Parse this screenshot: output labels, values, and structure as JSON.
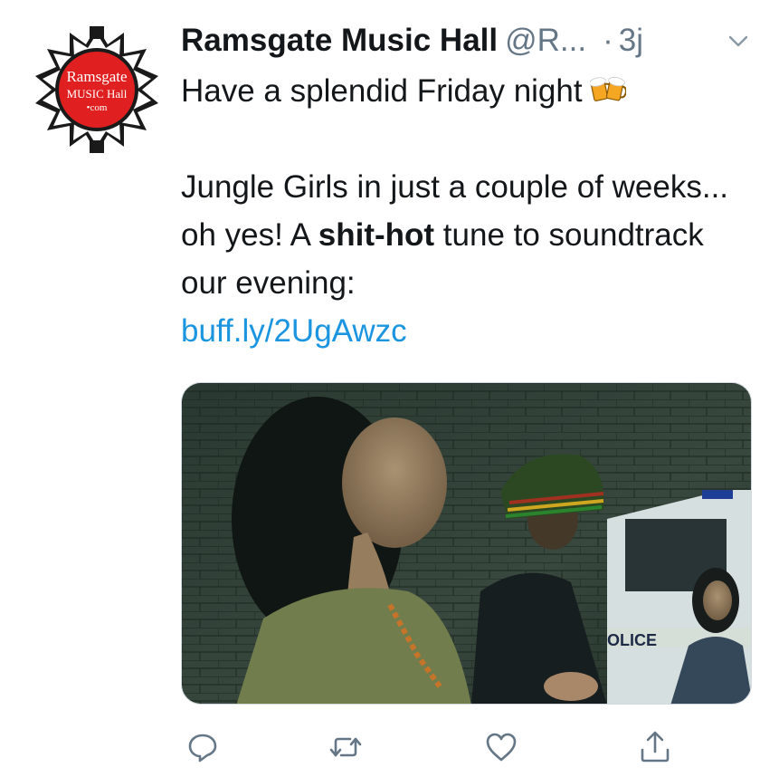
{
  "tweet": {
    "author": {
      "display_name": "Ramsgate Music Hall",
      "handle": "@R...",
      "avatar_icon": "ramsgate-music-hall-logo",
      "avatar_text": [
        "Ramsgate",
        "MUSIC Hall",
        "•com"
      ]
    },
    "separator": "·",
    "time": "3j",
    "menu_icon": "chevron-down-icon",
    "text": {
      "line1": "Have a splendid Friday night",
      "emoji": "beer-mugs-emoji",
      "para2_part1": "Jungle Girls in just a couple of weeks... oh yes! A ",
      "para2_bold": "shit-hot",
      "para2_part2": " tune to soundtrack our evening:",
      "link": "buff.ly/2UgAwzc"
    },
    "media": {
      "type": "video-still",
      "visible_text": "OLICE"
    },
    "actions": [
      {
        "name": "reply",
        "icon": "reply-icon"
      },
      {
        "name": "retweet",
        "icon": "retweet-icon"
      },
      {
        "name": "like",
        "icon": "heart-icon"
      },
      {
        "name": "share",
        "icon": "share-icon"
      }
    ]
  },
  "colors": {
    "text": "#14171a",
    "muted": "#657786",
    "link": "#1b95e0",
    "icon": "#657786",
    "logo_red": "#e02020"
  }
}
